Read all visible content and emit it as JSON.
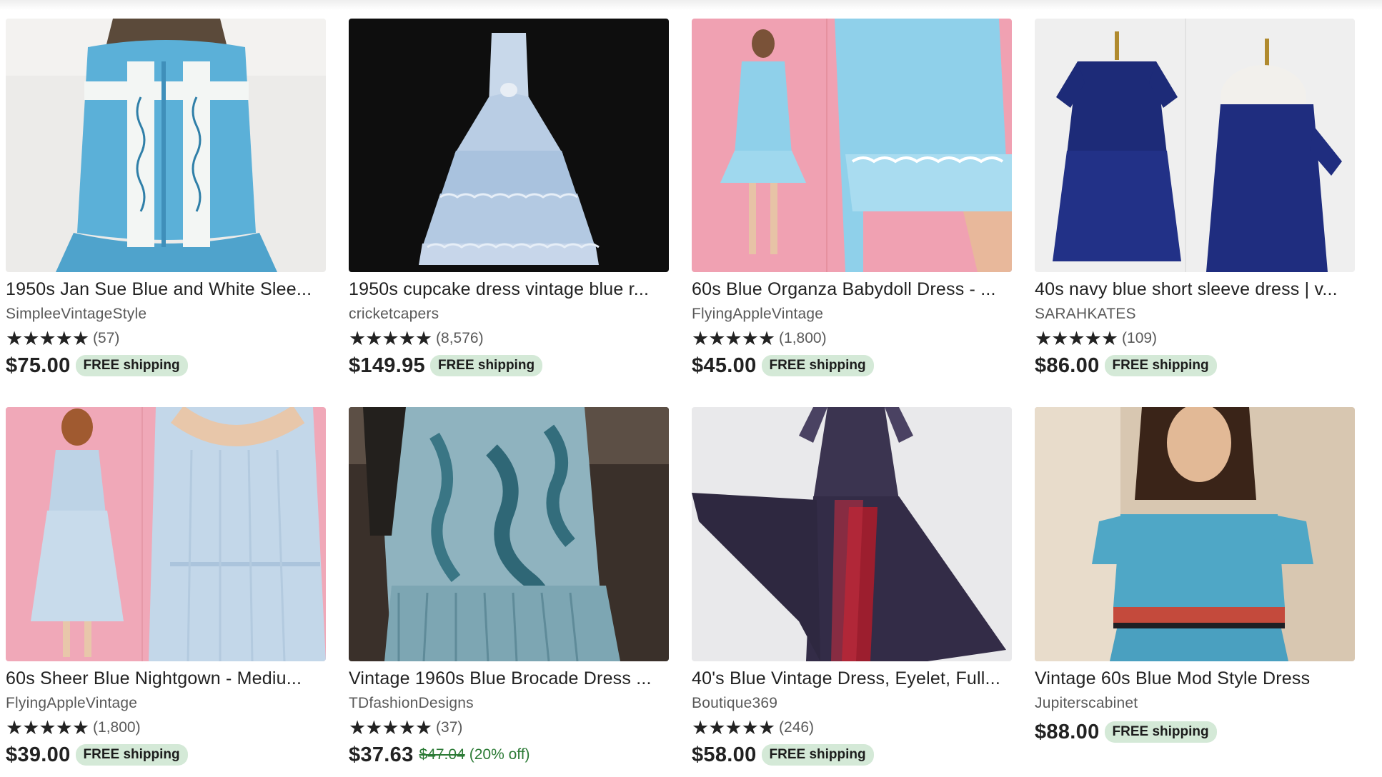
{
  "listings": [
    {
      "title": "1950s Jan Sue Blue and White Slee...",
      "shop": "SimpleeVintageStyle",
      "stars": "★★★★★",
      "reviews": "(57)",
      "price": "$75.00",
      "original_price": "",
      "discount": "",
      "shipping": "FREE shipping",
      "image": "light-blue-sleeveless-dress-on-dress-form-icon"
    },
    {
      "title": "1950s cupcake dress vintage blue r...",
      "shop": "cricketcapers",
      "stars": "★★★★★",
      "reviews": "(8,576)",
      "price": "$149.95",
      "original_price": "",
      "discount": "",
      "shipping": "FREE shipping",
      "image": "pale-blue-tiered-gown-icon"
    },
    {
      "title": "60s Blue Organza Babydoll Dress - ...",
      "shop": "FlyingAppleVintage",
      "stars": "★★★★★",
      "reviews": "(1,800)",
      "price": "$45.00",
      "original_price": "",
      "discount": "",
      "shipping": "FREE shipping",
      "image": "blue-babydoll-dress-model-icon"
    },
    {
      "title": "40s navy blue short sleeve dress | v...",
      "shop": "SARAHKATES",
      "stars": "★★★★★",
      "reviews": "(109)",
      "price": "$86.00",
      "original_price": "",
      "discount": "",
      "shipping": "FREE shipping",
      "image": "navy-dress-on-dress-form-icon"
    },
    {
      "title": "60s Sheer Blue Nightgown - Mediu...",
      "shop": "FlyingAppleVintage",
      "stars": "★★★★★",
      "reviews": "(1,800)",
      "price": "$39.00",
      "original_price": "",
      "discount": "",
      "shipping": "FREE shipping",
      "image": "sheer-blue-nightgown-model-icon"
    },
    {
      "title": "Vintage 1960s Blue Brocade Dress ...",
      "shop": "TDfashionDesigns",
      "stars": "★★★★★",
      "reviews": "(37)",
      "price": "$37.63",
      "original_price": "$47.04",
      "discount": "(20% off)",
      "shipping": "",
      "image": "teal-brocade-dress-icon"
    },
    {
      "title": "40's Blue Vintage Dress, Eyelet, Full...",
      "shop": "Boutique369",
      "stars": "★★★★★",
      "reviews": "(246)",
      "price": "$58.00",
      "original_price": "",
      "discount": "",
      "shipping": "FREE shipping",
      "image": "dark-purple-full-skirt-dress-icon"
    },
    {
      "title": "Vintage 60s Blue Mod Style Dress",
      "shop": "Jupiterscabinet",
      "stars": "",
      "reviews": "",
      "price": "$88.00",
      "original_price": "",
      "discount": "",
      "shipping": "FREE shipping",
      "image": "blue-mod-knit-dress-model-icon"
    }
  ],
  "colors": {
    "shipping_badge_bg": "#d4e9d7",
    "sale_green": "#2b7a35",
    "star": "#222222"
  }
}
